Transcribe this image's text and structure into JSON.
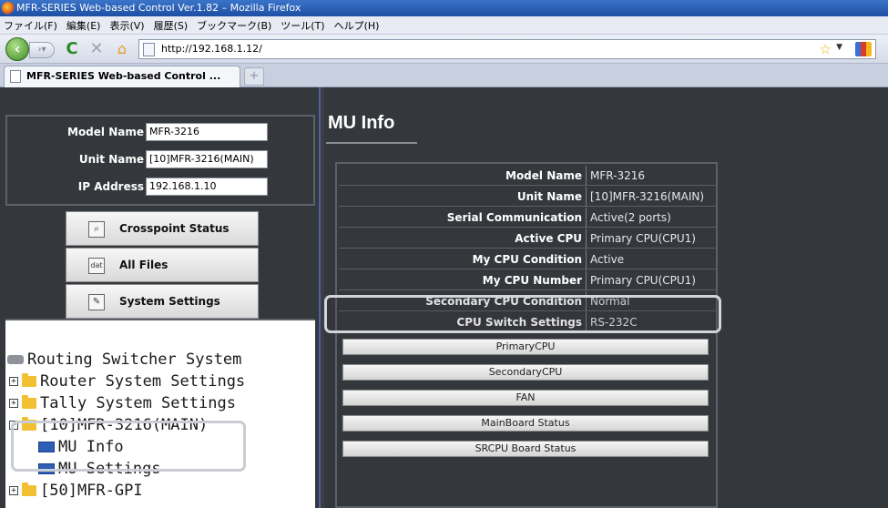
{
  "window": {
    "title": "MFR-SERIES Web-based Control Ver.1.82 – Mozilla Firefox"
  },
  "menu": [
    "ファイル(F)",
    "編集(E)",
    "表示(V)",
    "履歴(S)",
    "ブックマーク(B)",
    "ツール(T)",
    "ヘルプ(H)"
  ],
  "nav": {
    "url": "http://192.168.1.12/",
    "back_icon": "back-arrow-icon",
    "reload_icon": "reload-icon",
    "stop_icon": "stop-icon",
    "home_icon": "home-icon"
  },
  "tabs": {
    "active_label": "MFR-SERIES Web-based Control ...",
    "new_tab": "+"
  },
  "device": {
    "model_label": "Model Name",
    "model_value": "MFR-3216",
    "unit_label": "Unit Name",
    "unit_value": "[10]MFR-3216(MAIN)",
    "ip_label": "IP Address",
    "ip_value": "192.168.1.10"
  },
  "side_buttons": {
    "crosspoint": "Crosspoint Status",
    "files": "All Files",
    "files_icon": "dat",
    "settings": "System Settings"
  },
  "tree": {
    "root": "Routing Switcher System",
    "router": "Router System Settings",
    "tally": "Tally System Settings",
    "unit": "[10]MFR-3216(MAIN)",
    "mu_info": "MU Info",
    "mu_settings": "MU Settings",
    "gpi": "[50]MFR-GPI",
    "plus": "+",
    "minus": "−"
  },
  "main": {
    "title": "MU Info",
    "rows": [
      {
        "key": "Model Name",
        "value": "MFR-3216"
      },
      {
        "key": "Unit Name",
        "value": "[10]MFR-3216(MAIN)"
      },
      {
        "key": "Serial Communication",
        "value": "Active(2 ports)"
      },
      {
        "key": "Active CPU",
        "value": "Primary CPU(CPU1)"
      },
      {
        "key": "My CPU Condition",
        "value": "Active"
      },
      {
        "key": "My CPU Number",
        "value": "Primary CPU(CPU1)"
      },
      {
        "key": "Secondary CPU Condition",
        "value": "Normal"
      },
      {
        "key": "CPU Switch Settings",
        "value": "RS-232C"
      }
    ],
    "buttons": [
      "PrimaryCPU",
      "SecondaryCPU",
      "FAN",
      "MainBoard Status",
      "SRCPU Board Status"
    ]
  },
  "colors": {
    "panel_bg": "#34373c",
    "tree_bg": "#ffffff",
    "folder": "#f2c032"
  }
}
